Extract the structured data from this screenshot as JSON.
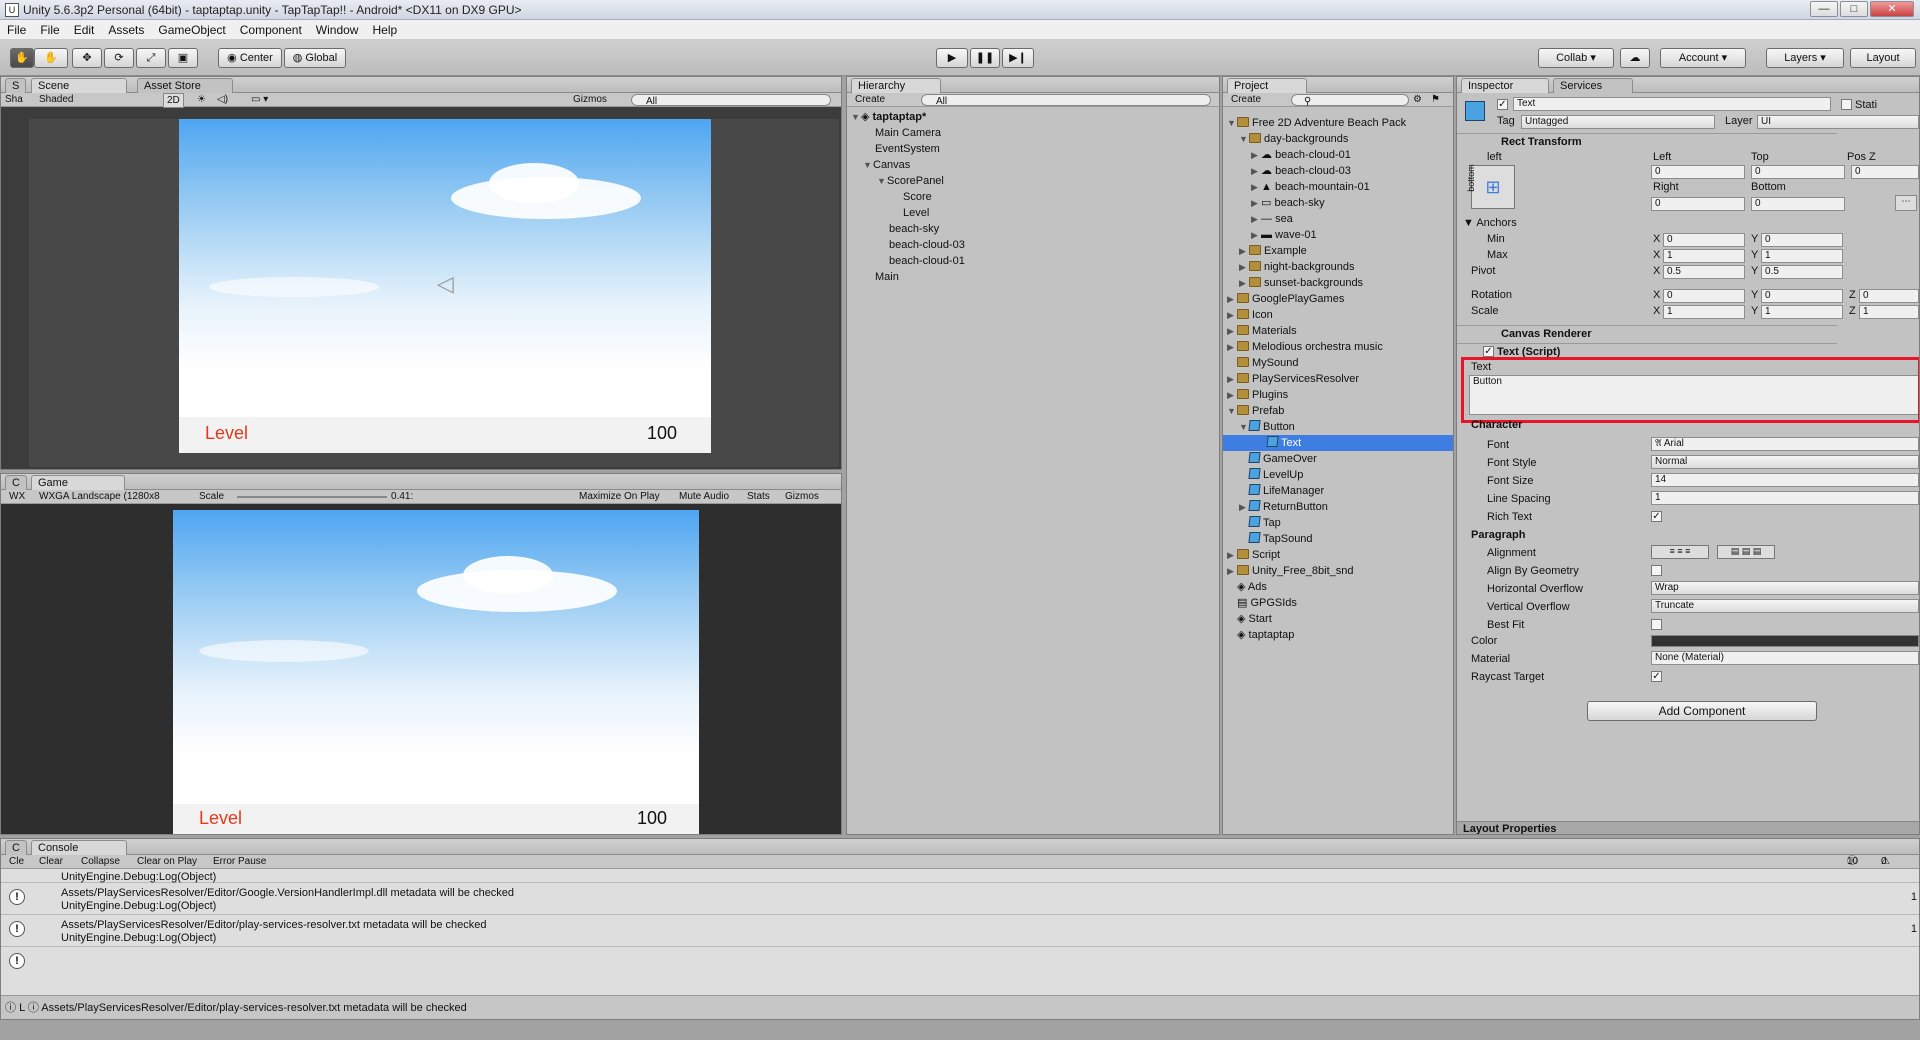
{
  "title_bar": {
    "text": "Unity 5.6.3p2 Personal (64bit) - taptaptap.unity - TapTapTap!! - Android* <DX11 on DX9 GPU>",
    "logo_text": "U",
    "minimize": "—",
    "maximize": "□",
    "close": "✕"
  },
  "menu": [
    "File",
    "File",
    "Edit",
    "Assets",
    "GameObject",
    "Component",
    "Window",
    "Help"
  ],
  "toolbar": {
    "pivot": "Center",
    "space": "Global",
    "collab": "Collab ▾",
    "account": "Account",
    "layers": "Layers",
    "layout": "Layout"
  },
  "scene": {
    "tabs": [
      "S",
      "Scene",
      "Asset Store"
    ],
    "shading": "Shaded",
    "sh": "Sha",
    "mode2d": "2D",
    "gizmos": "Gizmos",
    "search": "All",
    "level_label": "Level",
    "score": "100"
  },
  "game": {
    "tabs": [
      "C",
      "Game"
    ],
    "wx": "WX",
    "resolution": "WXGA Landscape (1280x8",
    "scale_label": "Scale",
    "scale_value": "0.41:",
    "buttons": [
      "Maximize On Play",
      "Mute Audio",
      "Stats",
      "Gizmos"
    ],
    "level_label": "Level",
    "score": "100"
  },
  "hierarchy": {
    "tab": "Hierarchy",
    "create": "Create",
    "search": "All",
    "scene_name": "taptaptap*",
    "items": [
      "Main Camera",
      "EventSystem",
      "Canvas",
      "ScorePanel",
      "Score",
      "Level",
      "beach-sky",
      "beach-cloud-03",
      "beach-cloud-01",
      "Main"
    ]
  },
  "project": {
    "tab": "Project",
    "create": "Create",
    "items": [
      "Free 2D Adventure Beach Pack",
      "day-backgrounds",
      "beach-cloud-01",
      "beach-cloud-03",
      "beach-mountain-01",
      "beach-sky",
      "sea",
      "wave-01",
      "Example",
      "night-backgrounds",
      "sunset-backgrounds",
      "GooglePlayGames",
      "Icon",
      "Materials",
      "Melodious orchestra music",
      "MySound",
      "PlayServicesResolver",
      "Plugins",
      "Prefab",
      "Button",
      "Text",
      "GameOver",
      "LevelUp",
      "LifeManager",
      "ReturnButton",
      "Tap",
      "TapSound",
      "Script",
      "Unity_Free_8bit_snd",
      "Ads",
      "GPGSIds",
      "Start",
      "taptaptap"
    ]
  },
  "inspector": {
    "tabs": [
      "Inspector",
      "Services"
    ],
    "object_name": "Text",
    "static": "Stati",
    "tag_label": "Tag",
    "tag_value": "Untagged",
    "layer_label": "Layer",
    "layer_value": "UI",
    "rect_transform": "Rect Transform",
    "anchor_h": "left",
    "anchor_v": "bottom",
    "left_label": "Left",
    "top_label": "Top",
    "posz_label": "Pos Z",
    "right_label": "Right",
    "bottom_label": "Bottom",
    "left": "0",
    "top": "0",
    "posz": "0",
    "right": "0",
    "bottom": "0",
    "anchors": "Anchors",
    "min": "Min",
    "max": "Max",
    "pivot": "Pivot",
    "rotation": "Rotation",
    "scale": "Scale",
    "x": "X",
    "y": "Y",
    "z": "Z",
    "min_x": "0",
    "min_y": "0",
    "max_x": "1",
    "max_y": "1",
    "pivot_x": "0.5",
    "pivot_y": "0.5",
    "rot_x": "0",
    "rot_y": "0",
    "rot_z": "0",
    "scale_x": "1",
    "scale_y": "1",
    "scale_z": "1",
    "canvas_renderer": "Canvas Renderer",
    "text_script": "Text (Script)",
    "text_label": "Text",
    "text_value": "Button",
    "character": "Character",
    "font_label": "Font",
    "font_value": "Arial",
    "font_style_label": "Font Style",
    "font_style_value": "Normal",
    "font_size_label": "Font Size",
    "font_size_value": "14",
    "line_spacing_label": "Line Spacing",
    "line_spacing_value": "1",
    "rich_text_label": "Rich Text",
    "paragraph": "Paragraph",
    "alignment_label": "Alignment",
    "align_geometry_label": "Align By Geometry",
    "h_overflow_label": "Horizontal Overflow",
    "h_overflow_value": "Wrap",
    "v_overflow_label": "Vertical Overflow",
    "v_overflow_value": "Truncate",
    "best_fit_label": "Best Fit",
    "color_label": "Color",
    "material_label": "Material",
    "material_value": "None (Material)",
    "raycast_label": "Raycast Target",
    "add_component": "Add Component",
    "layout_properties": "Layout Properties"
  },
  "console": {
    "tabs": [
      "C",
      "Console"
    ],
    "buttons": [
      "Cle",
      "Clear",
      "Collapse",
      "Clear on Play",
      "Error Pause"
    ],
    "count": "10",
    "count2": "0",
    "top_line": "UnityEngine.Debug:Log(Object)",
    "entries": [
      {
        "msg": "Assets/PlayServicesResolver/Editor/Google.VersionHandlerImpl.dll metadata will be checked",
        "sub": "UnityEngine.Debug:Log(Object)",
        "n": "1"
      },
      {
        "msg": "Assets/PlayServicesResolver/Editor/play-services-resolver.txt metadata will be checked",
        "sub": "UnityEngine.Debug:Log(Object)",
        "n": "1"
      }
    ],
    "status": "Assets/PlayServicesResolver/Editor/play-services-resolver.txt metadata will be checked",
    "status_prefix": "L"
  },
  "colors": {
    "selection": "#3e7ee3",
    "highlight": "#e8142a",
    "level_text": "#e03a1a"
  }
}
